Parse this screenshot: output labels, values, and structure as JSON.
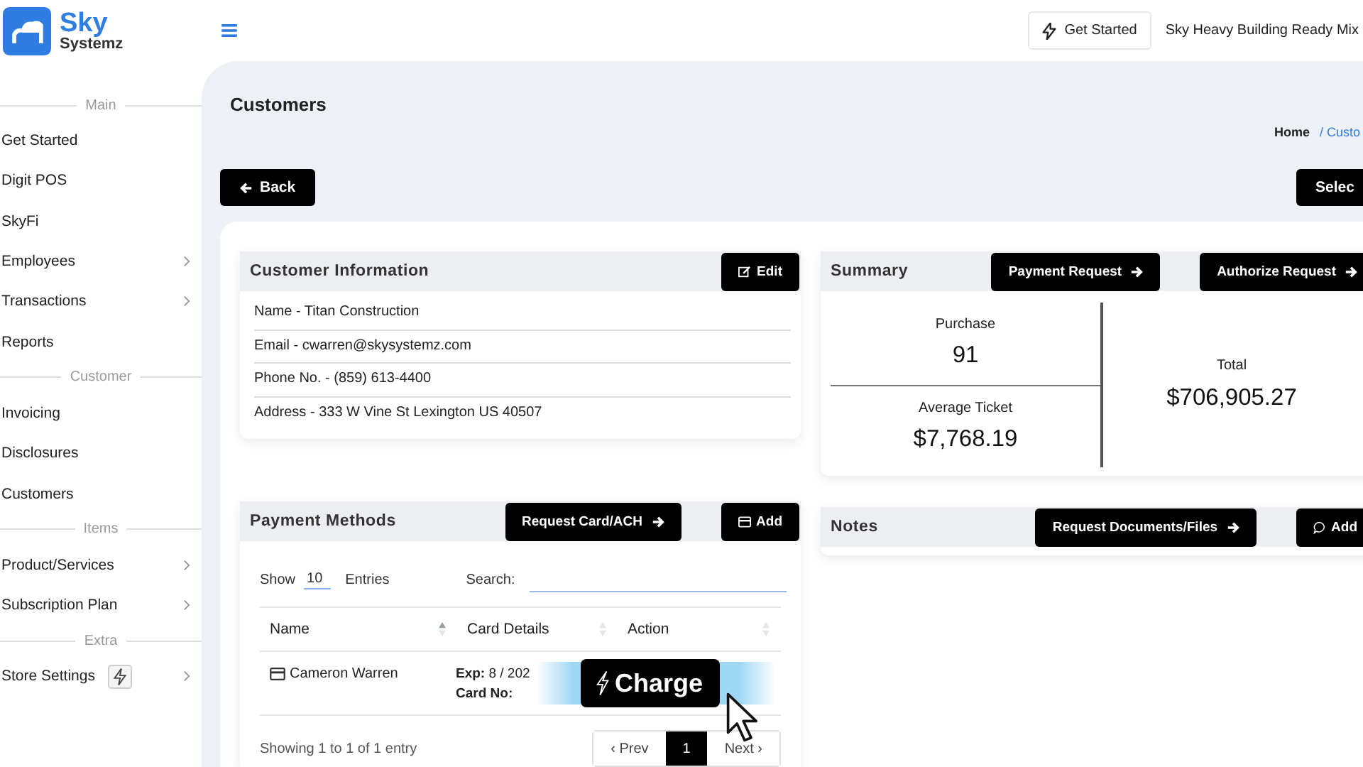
{
  "header": {
    "logo": {
      "line1": "Sky",
      "line2": "Systemz"
    },
    "get_started": "Get Started",
    "company": "Sky Heavy Building Ready Mix"
  },
  "sidebar": {
    "sections": [
      {
        "label": "Main",
        "items": [
          {
            "label": "Get Started",
            "has_submenu": false,
            "has_badge": false
          },
          {
            "label": "Digit POS",
            "has_submenu": false,
            "has_badge": false
          },
          {
            "label": "SkyFi",
            "has_submenu": false,
            "has_badge": false
          },
          {
            "label": "Employees",
            "has_submenu": true,
            "has_badge": false
          },
          {
            "label": "Transactions",
            "has_submenu": true,
            "has_badge": false
          },
          {
            "label": "Reports",
            "has_submenu": false,
            "has_badge": false
          }
        ]
      },
      {
        "label": "Customer",
        "items": [
          {
            "label": "Invoicing",
            "has_submenu": false,
            "has_badge": false
          },
          {
            "label": "Disclosures",
            "has_submenu": false,
            "has_badge": false
          },
          {
            "label": "Customers",
            "has_submenu": false,
            "has_badge": false
          }
        ]
      },
      {
        "label": "Items",
        "items": [
          {
            "label": "Product/Services",
            "has_submenu": true,
            "has_badge": false
          },
          {
            "label": "Subscription Plan",
            "has_submenu": true,
            "has_badge": false
          }
        ]
      },
      {
        "label": "Extra",
        "items": [
          {
            "label": "Store Settings",
            "has_submenu": true,
            "has_badge": true
          }
        ]
      }
    ]
  },
  "page": {
    "title": "Customers",
    "breadcrumb": [
      "Home",
      "/ Custo"
    ],
    "back_button": "Back",
    "top_right_button": "Selec"
  },
  "customer_info": {
    "title": "Customer Information",
    "edit_button": "Edit",
    "rows": [
      "Name - Titan Construction",
      "Email - cwarren@skysystemz.com",
      "Phone No. - (859) 613-4400",
      "Address - 333 W Vine St Lexington US 40507"
    ]
  },
  "summary": {
    "title": "Summary",
    "buttons": [
      "Payment Request",
      "Authorize Request"
    ],
    "purchase": {
      "label": "Purchase",
      "value": "91"
    },
    "average": {
      "label": "Average Ticket",
      "value": "$7,768.19"
    },
    "total": {
      "label": "Total",
      "value": "$706,905.27"
    }
  },
  "payment_methods": {
    "title": "Payment Methods",
    "buttons": [
      {
        "label": "Request Card/ACH",
        "kind": "arrow"
      },
      {
        "label": "Add",
        "kind": "card"
      }
    ],
    "show_label": "Show",
    "entries_value": "10",
    "entries_label": "Entries",
    "search_label": "Search:",
    "columns": [
      {
        "label": "Name",
        "sorted": true
      },
      {
        "label": "Card Details",
        "sorted": false
      },
      {
        "label": "Action",
        "sorted": false
      }
    ],
    "rows": [
      {
        "name": "Cameron Warren",
        "exp": "**Exp:** 8 / 202",
        "card": "**Card No:**"
      }
    ],
    "info": "Showing 1 to 1 of 1 entry",
    "pagination": [
      {
        "label": "‹ Prev",
        "selected": false
      },
      {
        "label": "1",
        "selected": true
      },
      {
        "label": "Next ›",
        "selected": false
      }
    ],
    "charge_button": "Charge"
  },
  "notes": {
    "title": "Notes",
    "buttons": [
      {
        "label": "Request Documents/Files",
        "kind": "arrow"
      },
      {
        "label": "Add",
        "kind": "comment"
      }
    ]
  }
}
